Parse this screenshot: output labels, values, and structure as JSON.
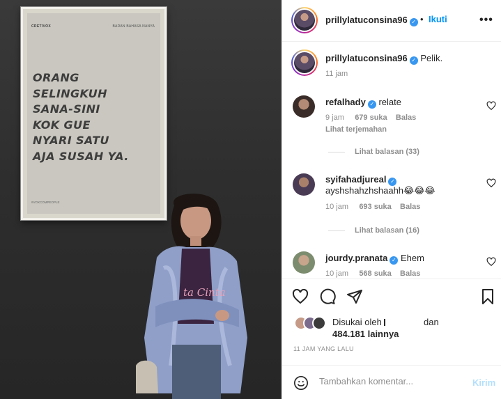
{
  "post": {
    "author": "prillylatuconsina96",
    "follow_label": "Ikuti",
    "dot": "•",
    "more": "•••",
    "poster": {
      "brand": "CRETIVOX",
      "brand_right": "BADAN BAHASA NANYA",
      "lines": [
        "ORANG",
        "SELINGKUH",
        "SANA-SINI",
        "KOK GUE",
        "NYARI SATU",
        "AJA SUSAH YA."
      ],
      "footer": "#VOXCOMPEOPLE"
    }
  },
  "caption": {
    "username": "prillylatuconsina96",
    "text": "Pelik.",
    "time": "11 jam"
  },
  "comments": [
    {
      "username": "refalhady",
      "text": "relate",
      "time": "9 jam",
      "likes": "679 suka",
      "reply": "Balas",
      "translate": "Lihat terjemahan",
      "view_replies": "Lihat balasan (33)"
    },
    {
      "username": "syifahadjureal",
      "text": "ayshshahzhshaahh😂😂😂",
      "time": "10 jam",
      "likes": "693 suka",
      "reply": "Balas",
      "view_replies": "Lihat balasan (16)"
    },
    {
      "username": "jourdy.pranata",
      "text": "Ehem",
      "time": "10 jam",
      "likes": "568 suka",
      "reply": "Balas"
    }
  ],
  "likes": {
    "liked_by": "Disukai oleh",
    "and": "dan",
    "count": "484.181 lainnya"
  },
  "timestamp": "11 JAM YANG LALU",
  "comment_box": {
    "placeholder": "Tambahkan komentar...",
    "post_label": "Kirim"
  },
  "icons": {
    "verified": "verified-badge-icon",
    "like": "heart-icon",
    "comment": "comment-bubble-icon",
    "share": "paper-plane-icon",
    "save": "bookmark-icon",
    "emoji": "smiley-icon"
  },
  "colors": {
    "accent": "#0095f6",
    "verified": "#3897f0",
    "muted": "#8e8e8e",
    "post_disabled": "#b2dffc"
  }
}
